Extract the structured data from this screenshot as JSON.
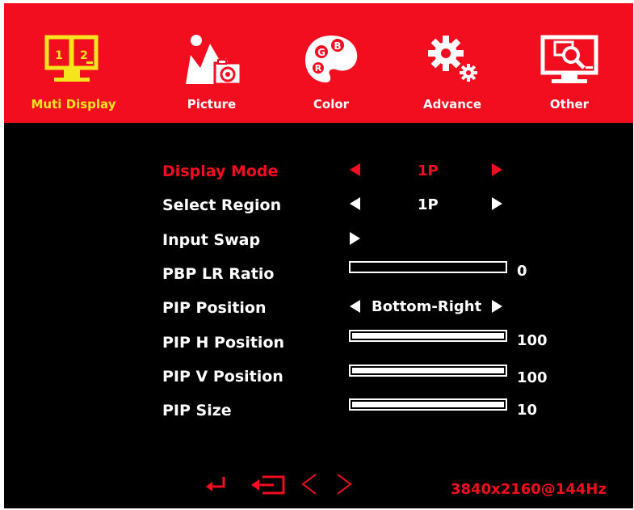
{
  "colors": {
    "accent": "#f20d1f",
    "active_tab_label": "#f5e51d",
    "text": "#ffffff",
    "background": "#000000"
  },
  "tabs": [
    {
      "label": "Muti Display",
      "icon": "multi-display-icon",
      "active": true
    },
    {
      "label": "Picture",
      "icon": "picture-icon",
      "active": false
    },
    {
      "label": "Color",
      "icon": "color-palette-icon",
      "active": false
    },
    {
      "label": "Advance",
      "icon": "gears-icon",
      "active": false
    },
    {
      "label": "Other",
      "icon": "monitor-search-icon",
      "active": false
    }
  ],
  "menu": {
    "display_mode": {
      "label": "Display Mode",
      "value": "1P",
      "selected": true
    },
    "select_region": {
      "label": "Select Region",
      "value": "1P"
    },
    "input_swap": {
      "label": "Input Swap"
    },
    "pbp_lr_ratio": {
      "label": "PBP LR Ratio",
      "value": "0",
      "fraction": 0.0
    },
    "pip_position": {
      "label": "PIP Position",
      "value": "Bottom-Right"
    },
    "pip_h_position": {
      "label": "PIP H Position",
      "value": "100",
      "fraction": 1.0
    },
    "pip_v_position": {
      "label": "PIP V Position",
      "value": "100",
      "fraction": 1.0
    },
    "pip_size": {
      "label": "PIP Size",
      "value": "10",
      "fraction": 1.0
    }
  },
  "footer": {
    "icons": [
      "enter-icon",
      "exit-icon",
      "left-chevron-icon",
      "right-chevron-icon"
    ],
    "resolution": "3840x2160@144Hz"
  }
}
